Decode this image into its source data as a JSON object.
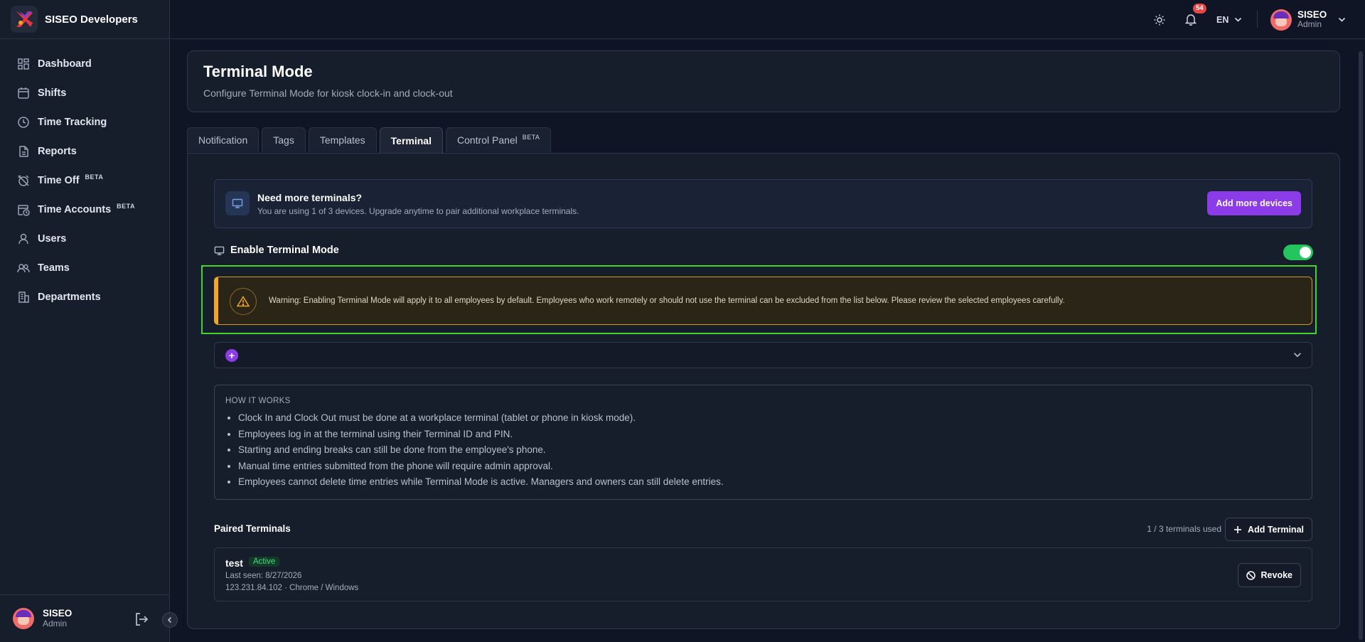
{
  "brand": {
    "title": "SISEO Developers"
  },
  "sidebar": {
    "items": [
      {
        "label": "Dashboard",
        "icon": "dashboard-icon"
      },
      {
        "label": "Shifts",
        "icon": "calendar-icon"
      },
      {
        "label": "Time Tracking",
        "icon": "clock-icon"
      },
      {
        "label": "Reports",
        "icon": "report-icon"
      },
      {
        "label": "Time Off",
        "icon": "alarm-off-icon",
        "beta": "BETA"
      },
      {
        "label": "Time Accounts",
        "icon": "calendar-clock-icon",
        "beta": "BETA"
      },
      {
        "label": "Users",
        "icon": "user-icon"
      },
      {
        "label": "Teams",
        "icon": "team-icon"
      },
      {
        "label": "Departments",
        "icon": "building-icon"
      }
    ],
    "footer": {
      "name": "SISEO",
      "role": "Admin"
    }
  },
  "topbar": {
    "notifications_count": "54",
    "language": "EN",
    "user": {
      "name": "SISEO",
      "role": "Admin"
    }
  },
  "header": {
    "title": "Terminal Mode",
    "subtitle": "Configure Terminal Mode for kiosk clock-in and clock-out"
  },
  "tabs": [
    {
      "label": "Notification"
    },
    {
      "label": "Tags"
    },
    {
      "label": "Templates"
    },
    {
      "label": "Terminal",
      "active": true
    },
    {
      "label": "Control Panel",
      "beta": "BETA"
    }
  ],
  "upgrade": {
    "title": "Need more terminals?",
    "subtitle": "You are using 1 of 3 devices. Upgrade anytime to pair additional workplace terminals.",
    "button": "Add more devices"
  },
  "enable": {
    "label": "Enable Terminal Mode",
    "enabled": true
  },
  "warning": {
    "text": "Warning: Enabling Terminal Mode will apply it to all employees by default. Employees who work remotely or should not use the terminal can be excluded from the list below. Please review the selected employees carefully."
  },
  "how_it_works": {
    "title": "HOW IT WORKS",
    "items": [
      "Clock In and Clock Out must be done at a workplace terminal (tablet or phone in kiosk mode).",
      "Employees log in at the terminal using their Terminal ID and PIN.",
      "Starting and ending breaks can still be done from the employee's phone.",
      "Manual time entries submitted from the phone will require admin approval.",
      "Employees cannot delete time entries while Terminal Mode is active. Managers and owners can still delete entries."
    ]
  },
  "paired": {
    "title": "Paired Terminals",
    "used": "1 / 3 terminals used",
    "add_button": "Add Terminal",
    "terminals": [
      {
        "name": "test",
        "status": "Active",
        "last_seen": "Last seen: 8/27/2026",
        "device": "123.231.84.102 · Chrome / Windows",
        "revoke": "Revoke"
      }
    ]
  },
  "colors": {
    "accent": "#8b3be8",
    "success": "#22c55e",
    "warning": "#f2a623",
    "highlight": "#3fd62f",
    "background": "#0f1524"
  }
}
